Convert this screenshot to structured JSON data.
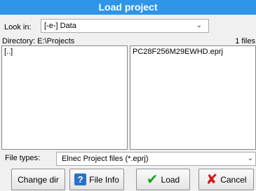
{
  "window": {
    "title": "Load project"
  },
  "look_in": {
    "label": "Look in:",
    "value": "[-e-]  Data"
  },
  "directory": {
    "text": "Directory: E:\\Projects",
    "file_count": "1 files"
  },
  "left_list": {
    "items": [
      "[..]"
    ]
  },
  "right_list": {
    "items": [
      "PC28F256M29EWHD.eprj"
    ]
  },
  "file_types": {
    "label": "File types:",
    "value": "Elnec Project files (*.eprj)"
  },
  "buttons": {
    "change_dir": "Change dir",
    "file_info": "File Info",
    "load": "Load",
    "cancel": "Cancel"
  },
  "colors": {
    "titlebar": "#2e95e8",
    "check_icon": "#18a21b",
    "cancel_icon": "#d11a1a",
    "help_icon": "#2a72c6"
  },
  "icons": {
    "file_info": "help-icon",
    "load": "check-icon",
    "cancel": "cross-icon"
  }
}
